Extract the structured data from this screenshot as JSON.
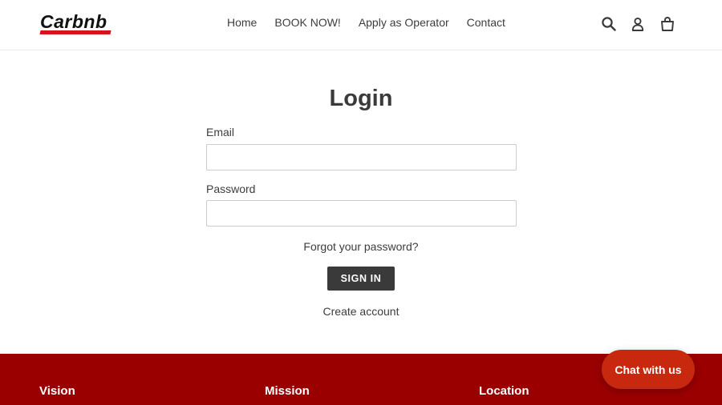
{
  "header": {
    "logo_text": "Carbnb",
    "nav": [
      "Home",
      "BOOK NOW!",
      "Apply as Operator",
      "Contact"
    ],
    "icons": [
      "search-icon",
      "account-icon",
      "cart-icon"
    ]
  },
  "main": {
    "title": "Login",
    "email_label": "Email",
    "email_value": "",
    "password_label": "Password",
    "password_value": "",
    "forgot_link": "Forgot your password?",
    "sign_in_label": "SIGN IN",
    "create_account_link": "Create account"
  },
  "footer": {
    "headings": [
      "Vision",
      "Mission",
      "Location"
    ]
  },
  "chat": {
    "label": "Chat with us"
  },
  "colors": {
    "brand_red": "#d9121f",
    "footer_bg": "#9b0000",
    "chat_bg": "#c8290e",
    "button_dark": "#3a3a3a"
  }
}
